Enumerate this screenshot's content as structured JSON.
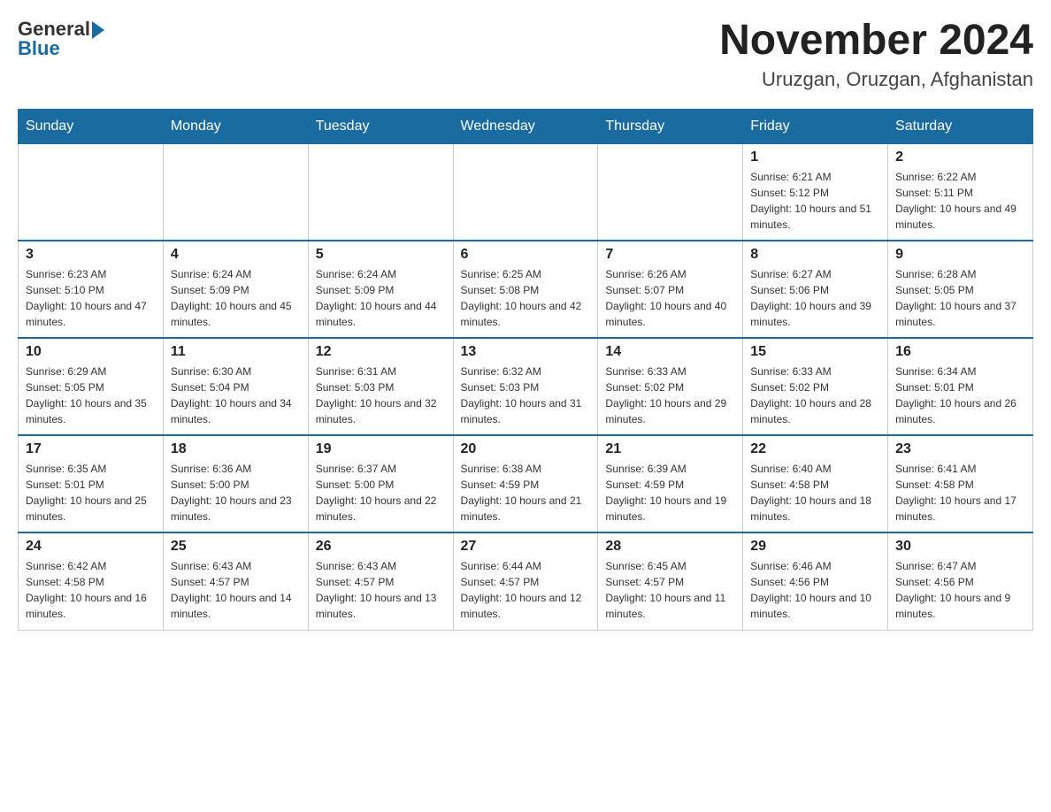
{
  "header": {
    "logo": {
      "general": "General",
      "blue": "Blue",
      "arrow": "▶"
    },
    "title": "November 2024",
    "location": "Uruzgan, Oruzgan, Afghanistan"
  },
  "days_of_week": [
    "Sunday",
    "Monday",
    "Tuesday",
    "Wednesday",
    "Thursday",
    "Friday",
    "Saturday"
  ],
  "weeks": [
    [
      {
        "day": "",
        "info": ""
      },
      {
        "day": "",
        "info": ""
      },
      {
        "day": "",
        "info": ""
      },
      {
        "day": "",
        "info": ""
      },
      {
        "day": "",
        "info": ""
      },
      {
        "day": "1",
        "info": "Sunrise: 6:21 AM\nSunset: 5:12 PM\nDaylight: 10 hours and 51 minutes."
      },
      {
        "day": "2",
        "info": "Sunrise: 6:22 AM\nSunset: 5:11 PM\nDaylight: 10 hours and 49 minutes."
      }
    ],
    [
      {
        "day": "3",
        "info": "Sunrise: 6:23 AM\nSunset: 5:10 PM\nDaylight: 10 hours and 47 minutes."
      },
      {
        "day": "4",
        "info": "Sunrise: 6:24 AM\nSunset: 5:09 PM\nDaylight: 10 hours and 45 minutes."
      },
      {
        "day": "5",
        "info": "Sunrise: 6:24 AM\nSunset: 5:09 PM\nDaylight: 10 hours and 44 minutes."
      },
      {
        "day": "6",
        "info": "Sunrise: 6:25 AM\nSunset: 5:08 PM\nDaylight: 10 hours and 42 minutes."
      },
      {
        "day": "7",
        "info": "Sunrise: 6:26 AM\nSunset: 5:07 PM\nDaylight: 10 hours and 40 minutes."
      },
      {
        "day": "8",
        "info": "Sunrise: 6:27 AM\nSunset: 5:06 PM\nDaylight: 10 hours and 39 minutes."
      },
      {
        "day": "9",
        "info": "Sunrise: 6:28 AM\nSunset: 5:05 PM\nDaylight: 10 hours and 37 minutes."
      }
    ],
    [
      {
        "day": "10",
        "info": "Sunrise: 6:29 AM\nSunset: 5:05 PM\nDaylight: 10 hours and 35 minutes."
      },
      {
        "day": "11",
        "info": "Sunrise: 6:30 AM\nSunset: 5:04 PM\nDaylight: 10 hours and 34 minutes."
      },
      {
        "day": "12",
        "info": "Sunrise: 6:31 AM\nSunset: 5:03 PM\nDaylight: 10 hours and 32 minutes."
      },
      {
        "day": "13",
        "info": "Sunrise: 6:32 AM\nSunset: 5:03 PM\nDaylight: 10 hours and 31 minutes."
      },
      {
        "day": "14",
        "info": "Sunrise: 6:33 AM\nSunset: 5:02 PM\nDaylight: 10 hours and 29 minutes."
      },
      {
        "day": "15",
        "info": "Sunrise: 6:33 AM\nSunset: 5:02 PM\nDaylight: 10 hours and 28 minutes."
      },
      {
        "day": "16",
        "info": "Sunrise: 6:34 AM\nSunset: 5:01 PM\nDaylight: 10 hours and 26 minutes."
      }
    ],
    [
      {
        "day": "17",
        "info": "Sunrise: 6:35 AM\nSunset: 5:01 PM\nDaylight: 10 hours and 25 minutes."
      },
      {
        "day": "18",
        "info": "Sunrise: 6:36 AM\nSunset: 5:00 PM\nDaylight: 10 hours and 23 minutes."
      },
      {
        "day": "19",
        "info": "Sunrise: 6:37 AM\nSunset: 5:00 PM\nDaylight: 10 hours and 22 minutes."
      },
      {
        "day": "20",
        "info": "Sunrise: 6:38 AM\nSunset: 4:59 PM\nDaylight: 10 hours and 21 minutes."
      },
      {
        "day": "21",
        "info": "Sunrise: 6:39 AM\nSunset: 4:59 PM\nDaylight: 10 hours and 19 minutes."
      },
      {
        "day": "22",
        "info": "Sunrise: 6:40 AM\nSunset: 4:58 PM\nDaylight: 10 hours and 18 minutes."
      },
      {
        "day": "23",
        "info": "Sunrise: 6:41 AM\nSunset: 4:58 PM\nDaylight: 10 hours and 17 minutes."
      }
    ],
    [
      {
        "day": "24",
        "info": "Sunrise: 6:42 AM\nSunset: 4:58 PM\nDaylight: 10 hours and 16 minutes."
      },
      {
        "day": "25",
        "info": "Sunrise: 6:43 AM\nSunset: 4:57 PM\nDaylight: 10 hours and 14 minutes."
      },
      {
        "day": "26",
        "info": "Sunrise: 6:43 AM\nSunset: 4:57 PM\nDaylight: 10 hours and 13 minutes."
      },
      {
        "day": "27",
        "info": "Sunrise: 6:44 AM\nSunset: 4:57 PM\nDaylight: 10 hours and 12 minutes."
      },
      {
        "day": "28",
        "info": "Sunrise: 6:45 AM\nSunset: 4:57 PM\nDaylight: 10 hours and 11 minutes."
      },
      {
        "day": "29",
        "info": "Sunrise: 6:46 AM\nSunset: 4:56 PM\nDaylight: 10 hours and 10 minutes."
      },
      {
        "day": "30",
        "info": "Sunrise: 6:47 AM\nSunset: 4:56 PM\nDaylight: 10 hours and 9 minutes."
      }
    ]
  ]
}
